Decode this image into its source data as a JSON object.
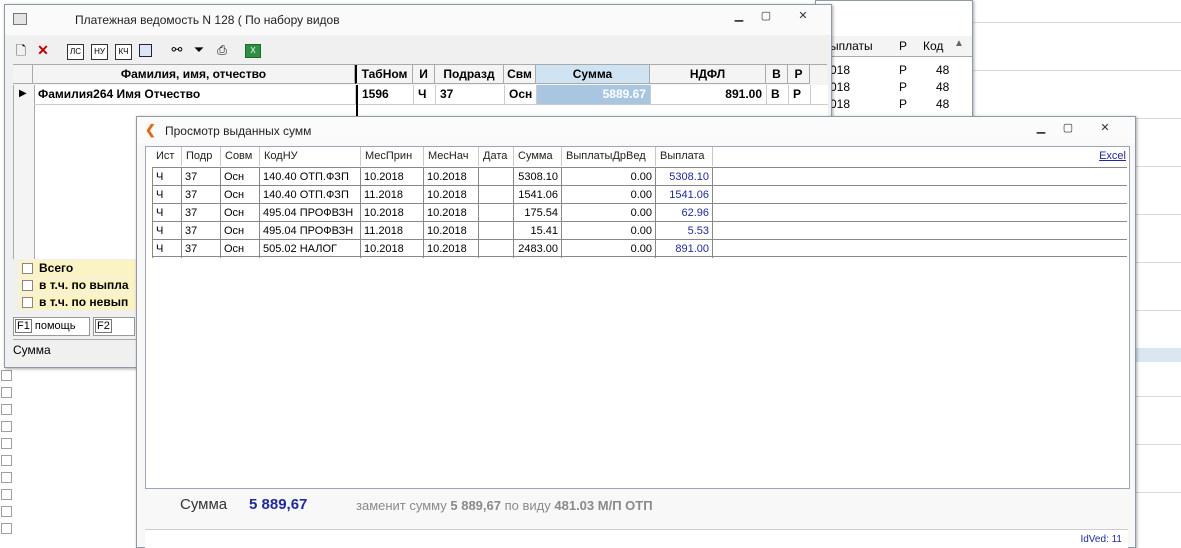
{
  "main_window": {
    "title": "Платежная ведомость N 128 ( По набору видов",
    "columns": [
      "Фамилия, имя, отчество",
      "ТабНом",
      "И",
      "Подразд",
      "Свм",
      "Сумма",
      "НДФЛ",
      "В",
      "Р"
    ],
    "row": {
      "fio": "Фамилия264 Имя Отчество",
      "tabnom": "1596",
      "i": "Ч",
      "podrazd": "37",
      "svm": "Осн",
      "summa": "5889.67",
      "ndfl": "891.00",
      "v": "В",
      "r": "Р"
    },
    "summary_rows": [
      "Всего",
      "в т.ч. по выпла",
      "в т.ч. по невып"
    ],
    "fkeys": [
      {
        "key": "F1",
        "label": "помощь"
      },
      {
        "key": "F2",
        "label": ""
      }
    ],
    "status_label": "Сумма"
  },
  "background_window": {
    "columns": [
      "ыплаты",
      "Р",
      "Код"
    ],
    "rows": [
      [
        "018",
        "Р",
        "48"
      ],
      [
        "018",
        "Р",
        "48"
      ],
      [
        "018",
        "Р",
        "48"
      ]
    ]
  },
  "dialog": {
    "title": "Просмотр выданных сумм",
    "excel_link": "Excel",
    "columns": [
      "Ист",
      "Подр",
      "Совм",
      "КодНУ",
      "МесПрин",
      "МесНач",
      "Дата",
      "Сумма",
      "ВыплатыДрВед",
      "Выплата"
    ],
    "rows": [
      [
        "Ч",
        "37",
        "Осн",
        "140.40 ОТП.ФЗП",
        "10.2018",
        "10.2018",
        "",
        "5308.10",
        "0.00",
        "5308.10"
      ],
      [
        "Ч",
        "37",
        "Осн",
        "140.40 ОТП.ФЗП",
        "11.2018",
        "10.2018",
        "",
        "1541.06",
        "0.00",
        "1541.06"
      ],
      [
        "Ч",
        "37",
        "Осн",
        "495.04 ПРОФВЗН",
        "10.2018",
        "10.2018",
        "",
        "175.54",
        "0.00",
        "62.96"
      ],
      [
        "Ч",
        "37",
        "Осн",
        "495.04 ПРОФВЗН",
        "11.2018",
        "10.2018",
        "",
        "15.41",
        "0.00",
        "5.53"
      ],
      [
        "Ч",
        "37",
        "Осн",
        "505.02 НАЛОГ",
        "10.2018",
        "10.2018",
        "",
        "2483.00",
        "0.00",
        "891.00"
      ]
    ],
    "footer": {
      "sum_label": "Сумма",
      "sum_value": "5 889,67",
      "replace_prefix": "заменит сумму",
      "replace_value": "5 889,67",
      "by_kind": "по виду",
      "kind_value": "481.03 М/П ОТП"
    },
    "idved": "IdVed: 11"
  },
  "colors": {
    "accent_blue": "#1f2a9a",
    "sum_bg": "#fbf3c4",
    "highlight": "#cfe3f3"
  }
}
